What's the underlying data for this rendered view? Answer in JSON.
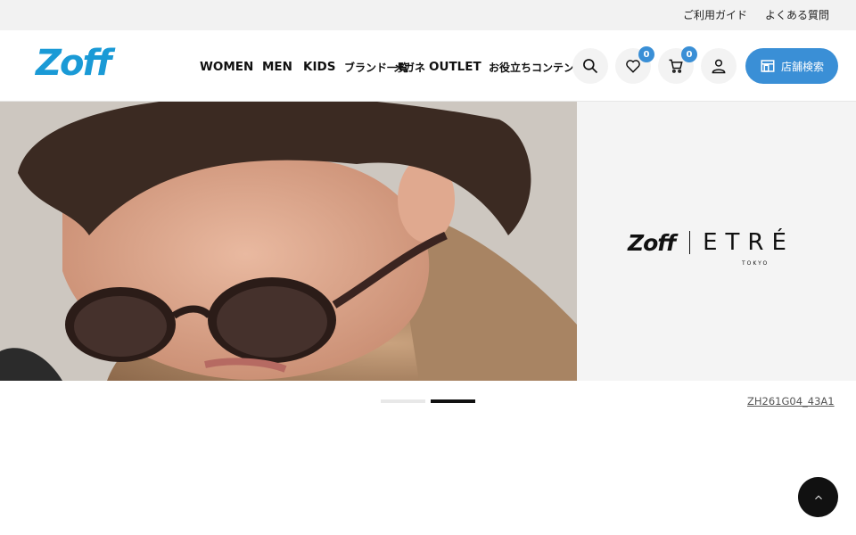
{
  "topbar": {
    "guide": "ご利用ガイド",
    "faq": "よくある質問"
  },
  "header": {
    "logo": "Zoff",
    "nav": [
      "WOMEN",
      "MEN",
      "KIDS",
      "ブランド一覧",
      "メガネ",
      "OUTLET",
      "お役立ちコンテンツ"
    ],
    "wishlist_count": "0",
    "cart_count": "0",
    "store_search": "店舗検索"
  },
  "hero": {
    "brand_left": "Zoff",
    "brand_right": "ETRÉ",
    "brand_sub": "TOKYO",
    "product_code": "ZH261G04_43A1"
  },
  "colors": {
    "brand_blue": "#1a9ad6",
    "accent_blue": "#3a8fd6",
    "topbar_bg": "#f2f2f2"
  },
  "icons": [
    "search-icon",
    "heart-icon",
    "cart-icon",
    "user-icon",
    "store-icon",
    "chevron-up-icon"
  ]
}
